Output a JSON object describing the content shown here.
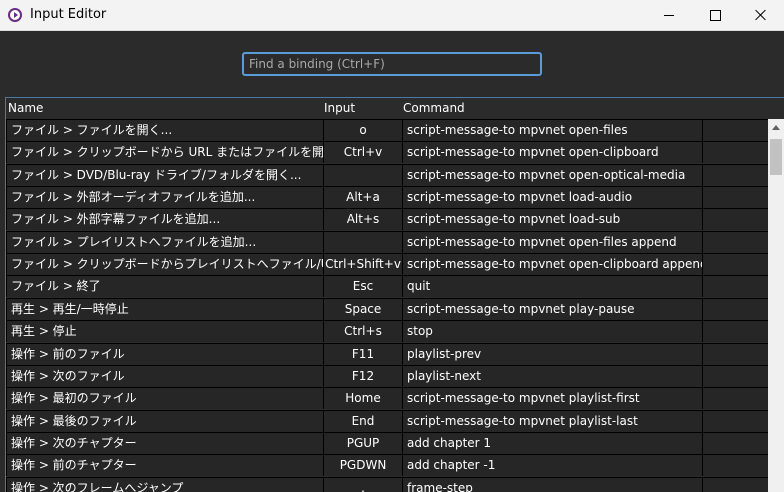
{
  "window": {
    "title": "Input Editor"
  },
  "search": {
    "placeholder": "Find a binding (Ctrl+F)",
    "value": ""
  },
  "columns": {
    "name": "Name",
    "input": "Input",
    "command": "Command"
  },
  "rows": [
    {
      "name": "ファイル > ファイルを開く...",
      "input": "o",
      "command": "script-message-to mpvnet open-files"
    },
    {
      "name": "ファイル > クリップボードから URL またはファイルを開く",
      "input": "Ctrl+v",
      "command": "script-message-to mpvnet open-clipboard"
    },
    {
      "name": "ファイル > DVD/Blu-ray ドライブ/フォルダを開く...",
      "input": "",
      "command": "script-message-to mpvnet open-optical-media"
    },
    {
      "name": "ファイル > 外部オーディオファイルを追加...",
      "input": "Alt+a",
      "command": "script-message-to mpvnet load-audio"
    },
    {
      "name": "ファイル > 外部字幕ファイルを追加...",
      "input": "Alt+s",
      "command": "script-message-to mpvnet load-sub"
    },
    {
      "name": "ファイル > プレイリストへファイルを追加...",
      "input": "",
      "command": "script-message-to mpvnet open-files append"
    },
    {
      "name": "ファイル > クリップボードからプレイリストへファイル/URL を追加",
      "input": "Ctrl+Shift+v",
      "command": "script-message-to mpvnet open-clipboard append"
    },
    {
      "name": "ファイル > 終了",
      "input": "Esc",
      "command": "quit"
    },
    {
      "name": "再生 > 再生/一時停止",
      "input": "Space",
      "command": "script-message-to mpvnet play-pause"
    },
    {
      "name": "再生 > 停止",
      "input": "Ctrl+s",
      "command": "stop"
    },
    {
      "name": "操作 > 前のファイル",
      "input": "F11",
      "command": "playlist-prev"
    },
    {
      "name": "操作 > 次のファイル",
      "input": "F12",
      "command": "playlist-next"
    },
    {
      "name": "操作 > 最初のファイル",
      "input": "Home",
      "command": "script-message-to mpvnet playlist-first"
    },
    {
      "name": "操作 > 最後のファイル",
      "input": "End",
      "command": "script-message-to mpvnet playlist-last"
    },
    {
      "name": "操作 > 次のチャプター",
      "input": "PGUP",
      "command": "add chapter 1"
    },
    {
      "name": "操作 > 前のチャプター",
      "input": "PGDWN",
      "command": "add chapter -1"
    },
    {
      "name": "操作 > 次のフレームへジャンプ",
      "input": ".",
      "command": "frame-step"
    }
  ]
}
